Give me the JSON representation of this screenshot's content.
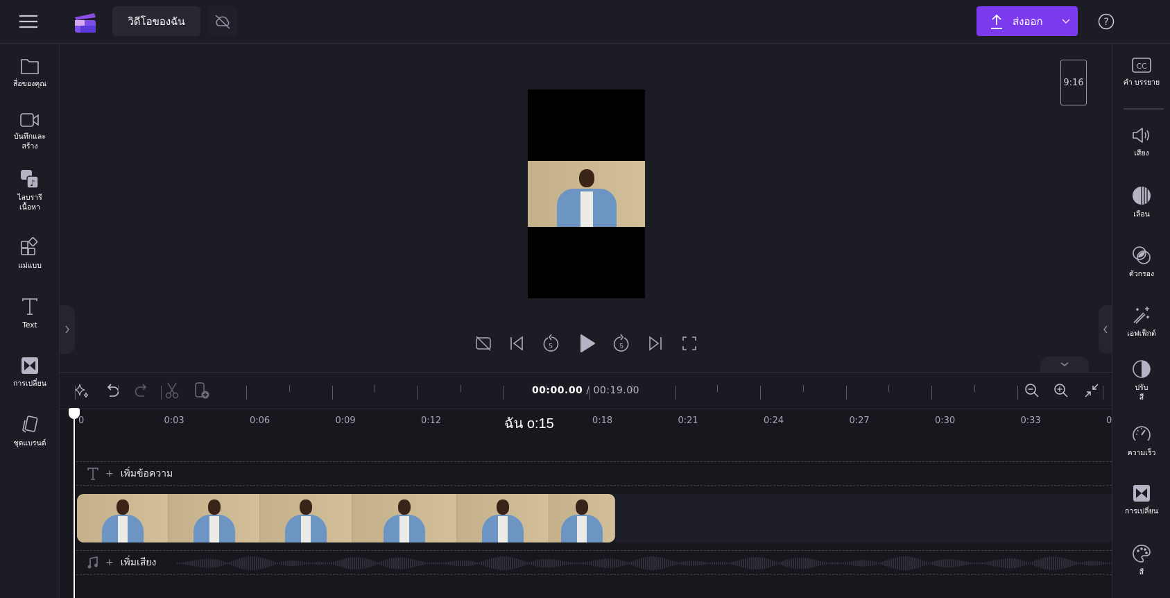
{
  "header": {
    "project_title": "วิดีโอของฉัน",
    "export_label": "ส่งออก",
    "icons": [
      "menu-icon",
      "app-logo",
      "cloud-off-icon",
      "upload-icon",
      "chevron-down-icon",
      "help-icon"
    ]
  },
  "left_sidebar": {
    "items": [
      {
        "label": "สื่อของคุณ",
        "icon": "folder-icon"
      },
      {
        "label": "บันทึกและสร้าง",
        "icon": "video-camera-icon"
      },
      {
        "label": "ไลบรารีเนื้อหา",
        "icon": "content-library-icon"
      },
      {
        "label": "แม่แบบ",
        "icon": "templates-icon"
      },
      {
        "label": "Text",
        "icon": "text-icon"
      },
      {
        "label": "การเปลี่ยน",
        "icon": "transitions-icon"
      },
      {
        "label": "ชุดแบรนด์",
        "icon": "brand-kit-icon"
      }
    ]
  },
  "right_sidebar": {
    "items": [
      {
        "label": "คำ บรรยาย",
        "icon": "captions-icon"
      },
      {
        "label": "เสียง",
        "icon": "audio-icon"
      },
      {
        "label": "เลือน",
        "icon": "fade-icon"
      },
      {
        "label": "ตัวกรอง",
        "icon": "filters-icon"
      },
      {
        "label": "เอฟเฟ็กต์",
        "icon": "effects-icon"
      },
      {
        "label": "ปรับสี",
        "icon": "adjust-colors-icon"
      },
      {
        "label": "ความเร็ว",
        "icon": "speed-icon"
      },
      {
        "label": "การเปลี่ยน",
        "icon": "transition-icon"
      },
      {
        "label": "สี",
        "icon": "color-palette-icon"
      }
    ]
  },
  "preview": {
    "aspect_ratio": "9:16",
    "controls": [
      "captions-off",
      "skip-back",
      "rewind-5",
      "play",
      "forward-5",
      "skip-forward",
      "fullscreen"
    ]
  },
  "timeline": {
    "current_time": "00:00.00",
    "separator": " / ",
    "total_time": "00:19.00",
    "ruler_labels": [
      "0",
      "0:03",
      "0:06",
      "0:09",
      "0:12",
      "",
      "0:18",
      "0:21",
      "0:24",
      "0:27",
      "0:30",
      "0:33",
      "0"
    ],
    "ruler_overlay": "ฉัน o:15",
    "text_track_label": "เพิ่มข้อความ",
    "audio_track_label": "เพิ่มเสียง",
    "plus": "+"
  },
  "colors": {
    "accent": "#7c3aed",
    "background": "#1c1c25",
    "timeline_bg": "#17171e"
  }
}
